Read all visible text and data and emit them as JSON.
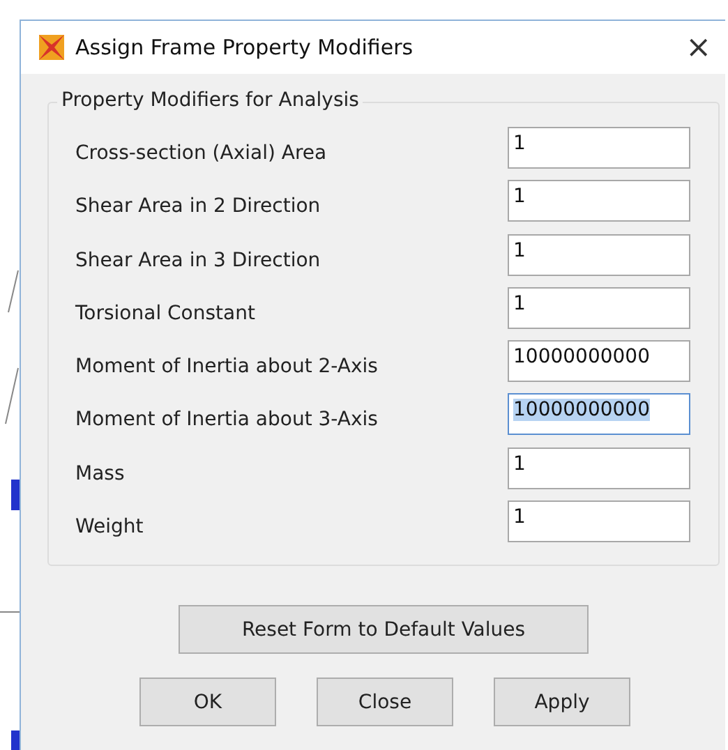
{
  "window": {
    "title": "Assign Frame Property Modifiers",
    "close": "×"
  },
  "group": {
    "title": "Property Modifiers for Analysis",
    "fields": [
      {
        "label": "Cross-section (Axial) Area",
        "value": "1",
        "selected": false
      },
      {
        "label": "Shear Area in 2 Direction",
        "value": "1",
        "selected": false
      },
      {
        "label": "Shear Area in 3 Direction",
        "value": "1",
        "selected": false
      },
      {
        "label": "Torsional Constant",
        "value": "1",
        "selected": false
      },
      {
        "label": "Moment of Inertia about 2-Axis",
        "value": "10000000000",
        "selected": false
      },
      {
        "label": "Moment of Inertia about 3-Axis",
        "value": "10000000000",
        "selected": true
      },
      {
        "label": "Mass",
        "value": "1",
        "selected": false
      },
      {
        "label": "Weight",
        "value": "1",
        "selected": false
      }
    ]
  },
  "reset_button": "Reset Form to Default Values",
  "buttons": [
    "OK",
    "Close",
    "Apply"
  ]
}
